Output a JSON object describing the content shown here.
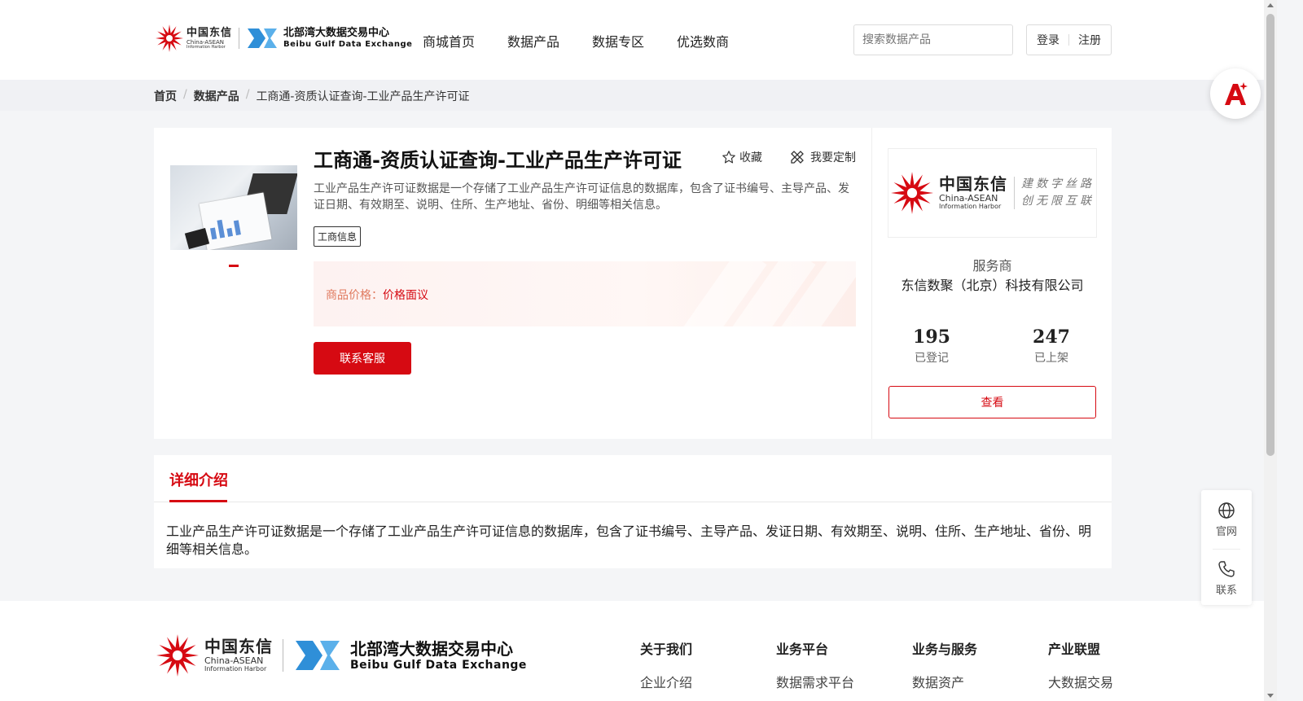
{
  "header": {
    "logo_ct_cn": "中国东信",
    "logo_ct_en1": "China-ASEAN",
    "logo_ct_en2": "Information Harbor",
    "logo_bb_cn": "北部湾大数据交易中心",
    "logo_bb_en": "Beibu Gulf Data Exchange",
    "nav": [
      "商城首页",
      "数据产品",
      "数据专区",
      "优选数商"
    ],
    "search_placeholder": "搜索数据产品",
    "login": "登录",
    "register": "注册"
  },
  "breadcrumb": [
    "首页",
    "数据产品",
    "工商通-资质认证查询-工业产品生产许可证"
  ],
  "product": {
    "title": "工商通-资质认证查询-工业产品生产许可证",
    "favorite": "收藏",
    "customize": "我要定制",
    "description": "工业产品生产许可证数据是一个存储了工业产品生产许可证信息的数据库，包含了证书编号、主导产品、发证日期、有效期至、说明、住所、生产地址、省份、明细等相关信息。",
    "tag": "工商信息",
    "price_label": "商品价格：",
    "price_value": "价格面议",
    "contact_button": "联系客服"
  },
  "provider": {
    "logo_cn": "中国东信",
    "logo_en1": "China-ASEAN",
    "logo_en2": "Information Harbor",
    "slogan_line1": "建数字丝路",
    "slogan_line2": "创无限互联",
    "role": "服务商",
    "name": "东信数聚（北京）科技有限公司",
    "stats": [
      {
        "value": "195",
        "label": "已登记"
      },
      {
        "value": "247",
        "label": "已上架"
      }
    ],
    "view_button": "查看"
  },
  "detail": {
    "tab": "详细介绍",
    "text": "工业产品生产许可证数据是一个存储了工业产品生产许可证信息的数据库，包含了证书编号、主导产品、发证日期、有效期至、说明、住所、生产地址、省份、明细等相关信息。"
  },
  "footer": {
    "columns": [
      {
        "heading": "关于我们",
        "link": "企业介绍"
      },
      {
        "heading": "业务平台",
        "link": "数据需求平台"
      },
      {
        "heading": "业务与服务",
        "link": "数据资产"
      },
      {
        "heading": "产业联盟",
        "link": "大数据交易"
      }
    ]
  },
  "float_bar": {
    "site": "官网",
    "contact": "联系"
  },
  "colors": {
    "brand_red": "#d60a12",
    "price_orange": "#e07a5f"
  },
  "icons": [
    "search-icon",
    "star-icon",
    "customize-icon",
    "globe-icon",
    "phone-icon",
    "ai-assistant-icon"
  ]
}
